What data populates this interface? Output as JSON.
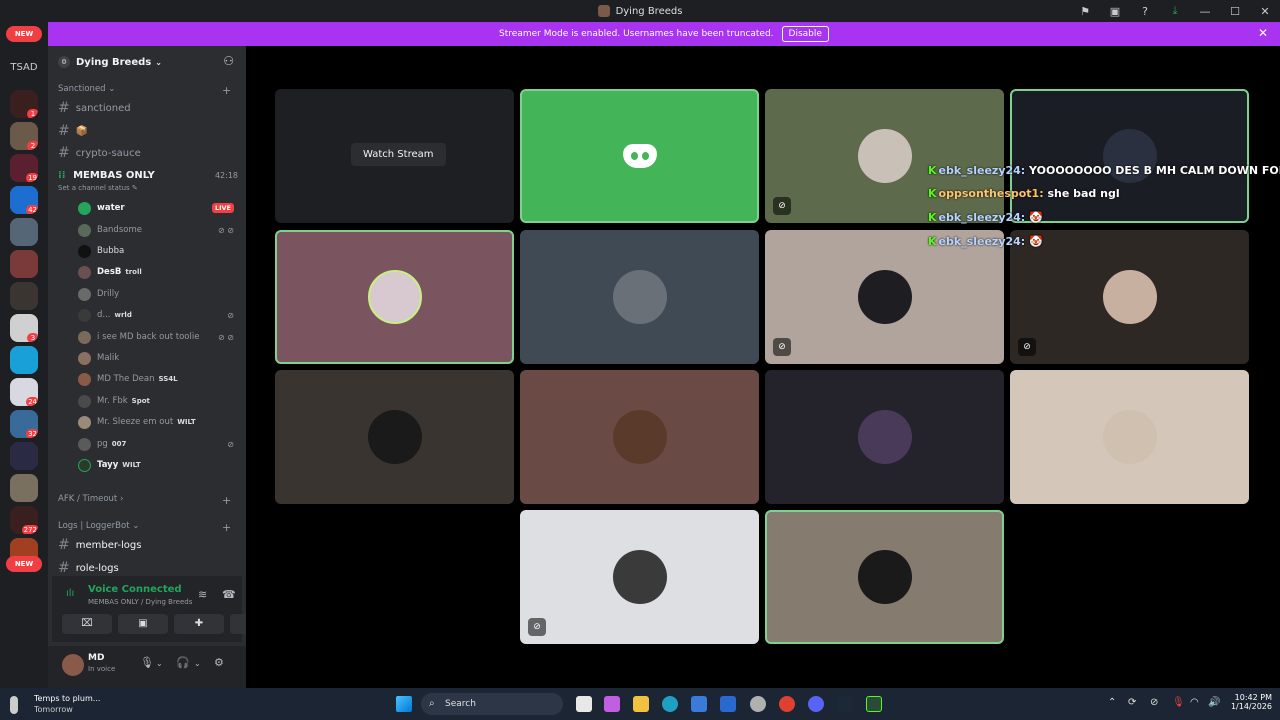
{
  "window": {
    "title": "Dying Breeds"
  },
  "banner": {
    "text": "Streamer Mode is enabled. Usernames have been truncated.",
    "disable_label": "Disable"
  },
  "guilds": {
    "tsad_label": "TSAD",
    "new_label": "NEW",
    "badges": [
      "1",
      "2",
      "19",
      "42",
      "3",
      "3",
      "24",
      "32",
      "272"
    ]
  },
  "server": {
    "name": "Dying Breeds",
    "server_icon": "0"
  },
  "categories": {
    "sanctioned": "Sanctioned",
    "afk": "AFK / Timeout",
    "logs": "Logs | LoggerBot"
  },
  "channels": {
    "sanctioned": "sanctioned",
    "box": "📦",
    "crypto": "crypto-sauce",
    "member_logs": "member-logs",
    "role_logs": "role-logs"
  },
  "voice_channel": {
    "name": "MEMBAS ONLY",
    "timer": "42:18",
    "status": "Set a channel status"
  },
  "members": [
    {
      "name": "water",
      "live": "LIVE"
    },
    {
      "name": "Bandsome"
    },
    {
      "name": "Bubba"
    },
    {
      "name": "DesB",
      "tag": "troll"
    },
    {
      "name": "Drilly"
    },
    {
      "name": "d...",
      "tag": "wrld"
    },
    {
      "name": "i see MD back out toolie"
    },
    {
      "name": "Malik"
    },
    {
      "name": "MD The Dean",
      "tag": "SS4L"
    },
    {
      "name": "Mr. Fbk",
      "tag": "Spot"
    },
    {
      "name": "Mr. Sleeze em out",
      "tag": "WILT"
    },
    {
      "name": "pg",
      "tag": "007"
    },
    {
      "name": "Tayy",
      "tag": "WILT"
    }
  ],
  "voice_panel": {
    "title": "Voice Connected",
    "subtitle": "MEMBAS ONLY / Dying Breeds"
  },
  "user": {
    "name": "MD",
    "status": "In voice"
  },
  "stream": {
    "watch_label": "Watch Stream"
  },
  "chat_overlay": [
    {
      "user": "ebk_sleezy24:",
      "text": "YOOOOOOOO DES B MH CALM DOWN FOR"
    },
    {
      "user": "oppsonthespot1:",
      "text": "she bad ngl"
    },
    {
      "user": "ebk_sleezy24:",
      "text": "🤡"
    },
    {
      "user": "ebk_sleezy24:",
      "text": "🤡"
    }
  ],
  "colors": {
    "accent": "#a833f0",
    "sidebar": "#2b2d31",
    "guild_bar": "#1e1f22",
    "voice_green": "#23a55a",
    "live_red": "#f23f43",
    "discord_tile": "#43b558"
  },
  "taskbar": {
    "weather_title": "Temps to plum...",
    "weather_sub": "Tomorrow",
    "search_label": "Search",
    "time": "10:42 PM",
    "date": "1/14/2026"
  }
}
